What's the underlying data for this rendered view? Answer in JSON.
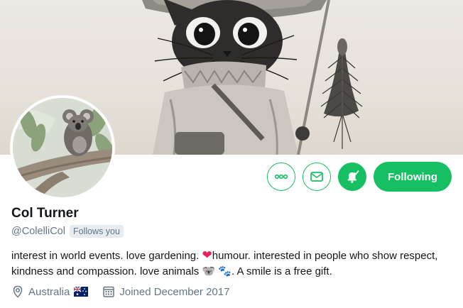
{
  "profile": {
    "name": "Col Turner",
    "handle": "@ColelliCol",
    "follows_you": "Follows you",
    "bio_part1": "interest in world events. love gardening.",
    "bio_heart": "❤",
    "bio_part2": "humour. interested in people who show respect, kindness and compassion. love animals",
    "bio_koala": "🐨",
    "bio_paws": "🐾",
    "bio_part3": ". A smile is a free gift.",
    "location": "Australia",
    "joined": "Joined December 2017"
  },
  "actions": {
    "more_icon": "more-icon",
    "message_icon": "mail-icon",
    "notifications_icon": "bell-check-icon",
    "following_label": "Following"
  },
  "colors": {
    "accent": "#17bf63",
    "secondary_text": "#657786",
    "heart": "#e0245e"
  }
}
